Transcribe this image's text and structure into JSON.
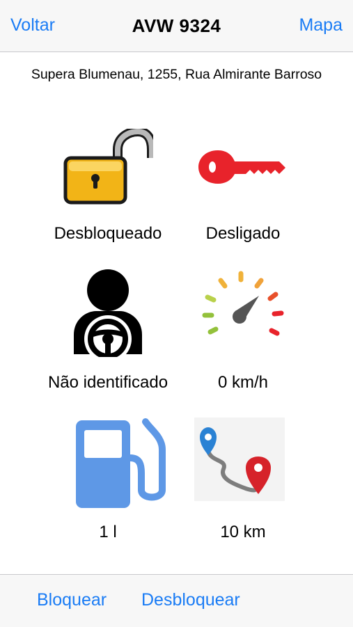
{
  "navbar": {
    "back_label": "Voltar",
    "title": "AVW 9324",
    "map_label": "Mapa"
  },
  "address": "Supera Blumenau, 1255, Rua Almirante Barroso",
  "status": {
    "lock": {
      "icon": "unlocked-padlock-icon",
      "label": "Desbloqueado"
    },
    "ignition": {
      "icon": "key-icon",
      "label": "Desligado"
    },
    "driver": {
      "icon": "driver-steering-wheel-icon",
      "label": "Não identificado"
    },
    "speed": {
      "icon": "speedometer-icon",
      "label": "0 km/h"
    },
    "fuel": {
      "icon": "fuel-pump-icon",
      "label": "1 l"
    },
    "distance": {
      "icon": "route-map-icon",
      "label": "10 km"
    }
  },
  "bottombar": {
    "block_label": "Bloquear",
    "unblock_label": "Desbloquear"
  },
  "colors": {
    "accent": "#1a7cf5",
    "key_red": "#e8232b",
    "fuel_blue": "#5e98e6",
    "padlock_gold": "#f2b417"
  }
}
